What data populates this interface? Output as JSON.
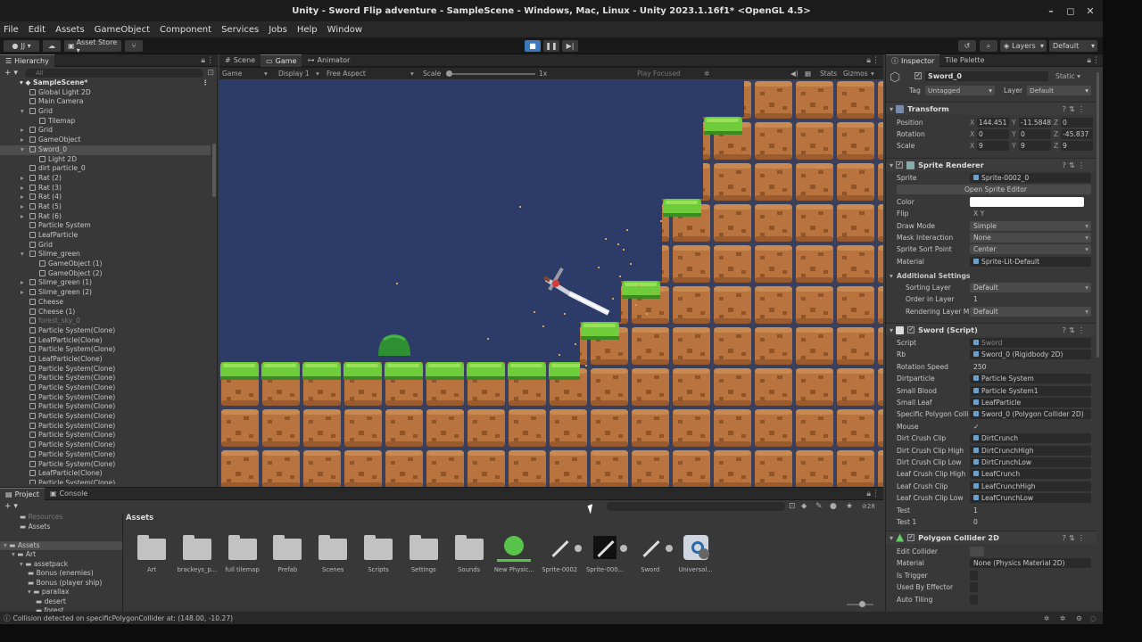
{
  "window": {
    "title": "Unity - Sword Flip adventure - SampleScene - Windows, Mac, Linux - Unity 2023.1.16f1* <OpenGL 4.5>",
    "controls": [
      "–",
      "◻",
      "✕"
    ]
  },
  "menu": [
    "File",
    "Edit",
    "Assets",
    "GameObject",
    "Component",
    "Services",
    "Jobs",
    "Help",
    "Window"
  ],
  "toolbar": {
    "account": "JJ ▾",
    "asset_store": "Asset Store ▾",
    "layers": "Layers",
    "layout": "Default"
  },
  "hierarchy": {
    "tab": "Hierarchy",
    "search_placeholder": "All",
    "scene": "SampleScene*",
    "items": [
      {
        "label": "Global Light 2D",
        "indent": 1
      },
      {
        "label": "Main Camera",
        "indent": 1
      },
      {
        "label": "Grid",
        "indent": 1,
        "arrow": "▾"
      },
      {
        "label": "Tilemap",
        "indent": 2
      },
      {
        "label": "Grid",
        "indent": 1,
        "arrow": "▸"
      },
      {
        "label": "GameObject",
        "indent": 1,
        "arrow": "▸"
      },
      {
        "label": "Sword_0",
        "indent": 1,
        "arrow": "▾",
        "selected": true
      },
      {
        "label": "Light 2D",
        "indent": 2
      },
      {
        "label": "dirt particle_0",
        "indent": 1
      },
      {
        "label": "Rat (2)",
        "indent": 1,
        "arrow": "▸"
      },
      {
        "label": "Rat (3)",
        "indent": 1,
        "arrow": "▸"
      },
      {
        "label": "Rat (4)",
        "indent": 1,
        "arrow": "▸"
      },
      {
        "label": "Rat (5)",
        "indent": 1,
        "arrow": "▸"
      },
      {
        "label": "Rat (6)",
        "indent": 1,
        "arrow": "▸"
      },
      {
        "label": "Particle System",
        "indent": 1
      },
      {
        "label": "LeafParticle",
        "indent": 1
      },
      {
        "label": "Grid",
        "indent": 1
      },
      {
        "label": "Slime_green",
        "indent": 1,
        "arrow": "▾"
      },
      {
        "label": "GameObject (1)",
        "indent": 2
      },
      {
        "label": "GameObject (2)",
        "indent": 2
      },
      {
        "label": "Slime_green (1)",
        "indent": 1,
        "arrow": "▸"
      },
      {
        "label": "Slime_green (2)",
        "indent": 1,
        "arrow": "▸"
      },
      {
        "label": "Cheese",
        "indent": 1
      },
      {
        "label": "Cheese (1)",
        "indent": 1
      },
      {
        "label": "forest_sky_0",
        "indent": 1,
        "dim": true
      },
      {
        "label": "Particle System(Clone)",
        "indent": 1
      },
      {
        "label": "LeafParticle(Clone)",
        "indent": 1
      },
      {
        "label": "Particle System(Clone)",
        "indent": 1
      },
      {
        "label": "LeafParticle(Clone)",
        "indent": 1
      },
      {
        "label": "Particle System(Clone)",
        "indent": 1
      },
      {
        "label": "Particle System(Clone)",
        "indent": 1
      },
      {
        "label": "Particle System(Clone)",
        "indent": 1
      },
      {
        "label": "Particle System(Clone)",
        "indent": 1
      },
      {
        "label": "Particle System(Clone)",
        "indent": 1
      },
      {
        "label": "Particle System(Clone)",
        "indent": 1
      },
      {
        "label": "Particle System(Clone)",
        "indent": 1
      },
      {
        "label": "Particle System(Clone)",
        "indent": 1
      },
      {
        "label": "Particle System(Clone)",
        "indent": 1
      },
      {
        "label": "Particle System(Clone)",
        "indent": 1
      },
      {
        "label": "Particle System(Clone)",
        "indent": 1
      },
      {
        "label": "LeafParticle(Clone)",
        "indent": 1
      },
      {
        "label": "Particle System(Clone)",
        "indent": 1
      },
      {
        "label": "LeafParticle(Clone)",
        "indent": 1
      }
    ]
  },
  "scene_tabs": [
    "Scene",
    "Game",
    "Animator"
  ],
  "game_bar": {
    "mode": "Game",
    "display": "Display 1",
    "aspect": "Free Aspect",
    "scale_label": "Scale",
    "scale_value": "1x",
    "play_focused": "Play Focused",
    "stats": "Stats",
    "gizmos": "Gizmos"
  },
  "project": {
    "tabs": [
      "Project",
      "Console"
    ],
    "breadcrumb": "Assets",
    "tree": [
      {
        "label": "Resources",
        "indent": 2,
        "dim": true
      },
      {
        "label": "Assets",
        "indent": 2
      },
      {
        "label": "",
        "indent": 0
      },
      {
        "label": "Assets",
        "indent": 0,
        "arrow": "▾",
        "selected": true
      },
      {
        "label": "Art",
        "indent": 1,
        "arrow": "▾"
      },
      {
        "label": "assetpack",
        "indent": 2,
        "arrow": "▾"
      },
      {
        "label": "Bonus (enemies)",
        "indent": 3
      },
      {
        "label": "Bonus (player ship)",
        "indent": 3
      },
      {
        "label": "parallax",
        "indent": 3,
        "arrow": "▾"
      },
      {
        "label": "desert",
        "indent": 4
      },
      {
        "label": "forest",
        "indent": 4
      }
    ],
    "assets": [
      {
        "label": "Art",
        "kind": "folder"
      },
      {
        "label": "brackeys_p...",
        "kind": "folder"
      },
      {
        "label": "full tilemap",
        "kind": "folder"
      },
      {
        "label": "Prefab",
        "kind": "folder"
      },
      {
        "label": "Scenes",
        "kind": "folder"
      },
      {
        "label": "Scripts",
        "kind": "folder"
      },
      {
        "label": "Settings",
        "kind": "folder"
      },
      {
        "label": "Sounds",
        "kind": "folder"
      },
      {
        "label": "New Physic...",
        "kind": "physics"
      },
      {
        "label": "Sprite-0002",
        "kind": "sword"
      },
      {
        "label": "Sprite-000...",
        "kind": "sword-dark"
      },
      {
        "label": "Sword",
        "kind": "sword"
      },
      {
        "label": "Universal...",
        "kind": "urp"
      }
    ],
    "hidden_count": "28"
  },
  "status": "Collision detected on specificPolygonCollider at: (148.00, -10.27)",
  "inspector": {
    "tabs": [
      "Inspector",
      "Tile Palette"
    ],
    "object_name": "Sword_0",
    "static_label": "Static",
    "tag_label": "Tag",
    "tag_value": "Untagged",
    "layer_label": "Layer",
    "layer_value": "Default",
    "transform": {
      "title": "Transform",
      "position": {
        "label": "Position",
        "x": "144.451",
        "y": "-11.5848",
        "z": "0"
      },
      "rotation": {
        "label": "Rotation",
        "x": "0",
        "y": "0",
        "z": "-45.837"
      },
      "scale": {
        "label": "Scale",
        "x": "9",
        "y": "9",
        "z": "9"
      }
    },
    "sprite_renderer": {
      "title": "Sprite Renderer",
      "rows": [
        {
          "k": "Sprite",
          "v": "Sprite-0002_0"
        },
        {
          "k": "",
          "v": "Open Sprite Editor"
        },
        {
          "k": "Color",
          "v": ""
        },
        {
          "k": "Flip",
          "v": "X  Y"
        },
        {
          "k": "Draw Mode",
          "v": "Simple"
        },
        {
          "k": "Mask Interaction",
          "v": "None"
        },
        {
          "k": "Sprite Sort Point",
          "v": "Center"
        },
        {
          "k": "Material",
          "v": "Sprite-Lit-Default"
        }
      ],
      "additional": "Additional Settings",
      "sub": [
        {
          "k": "Sorting Layer",
          "v": "Default"
        },
        {
          "k": "Order in Layer",
          "v": "1"
        },
        {
          "k": "Rendering Layer M",
          "v": "Default"
        }
      ]
    },
    "sword_script": {
      "title": "Sword (Script)",
      "rows": [
        {
          "k": "Script",
          "v": "Sword"
        },
        {
          "k": "Rb",
          "v": "Sword_0 (Rigidbody 2D)"
        },
        {
          "k": "Rotation Speed",
          "v": "250"
        },
        {
          "k": "Dirtparticle",
          "v": "Particle System"
        },
        {
          "k": "Small Blood",
          "v": "Particle System1"
        },
        {
          "k": "Small Leaf",
          "v": "LeafParticle"
        },
        {
          "k": "Specific Polygon Colli",
          "v": "Sword_0 (Polygon Collider 2D)"
        },
        {
          "k": "Mouse",
          "v": "✓"
        },
        {
          "k": "Dirt Crush Clip",
          "v": "DirtCrunch"
        },
        {
          "k": "Dirt Crush Clip High",
          "v": "DirtCrunchHigh"
        },
        {
          "k": "Dirt Crush Clip Low",
          "v": "DirtCrunchLow"
        },
        {
          "k": "Leaf Crush Clip High",
          "v": "LeafCrunch"
        },
        {
          "k": "Leaf Crush Clip",
          "v": "LeafCrunchHigh"
        },
        {
          "k": "Leaf Crush Clip Low",
          "v": "LeafCrunchLow"
        },
        {
          "k": "Test",
          "v": "1"
        },
        {
          "k": "Test 1",
          "v": "0"
        }
      ]
    },
    "polygon_collider": {
      "title": "Polygon Collider 2D",
      "rows": [
        {
          "k": "Edit Collider",
          "v": ""
        },
        {
          "k": "Material",
          "v": "None (Physics Material 2D)"
        },
        {
          "k": "Is Trigger",
          "v": ""
        },
        {
          "k": "Used By Effector",
          "v": ""
        },
        {
          "k": "Auto Tiling",
          "v": ""
        }
      ]
    }
  },
  "colors": {
    "sky": "#2c3b67",
    "dirt": "#b8733e",
    "grass": "#6fcc3a",
    "accent": "#3a79bb"
  }
}
